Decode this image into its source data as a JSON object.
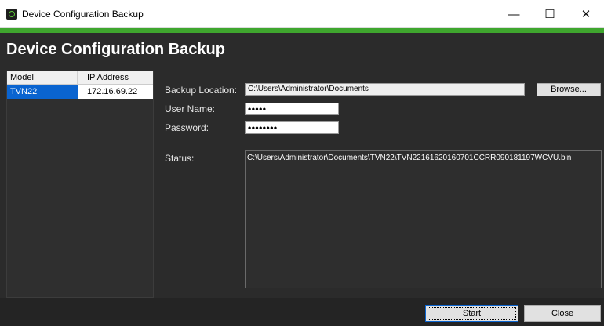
{
  "window": {
    "title": "Device Configuration Backup",
    "controls": {
      "minimize": "—",
      "maximize": "☐",
      "close": "✕"
    }
  },
  "header": {
    "title": "Device Configuration Backup"
  },
  "device_table": {
    "columns": [
      "Model",
      "IP Address"
    ],
    "rows": [
      {
        "model": "TVN22",
        "ip": "172.16.69.22"
      }
    ]
  },
  "form": {
    "backup_location_label": "Backup Location:",
    "backup_location_value": "C:\\Users\\Administrator\\Documents",
    "browse_label": "Browse...",
    "username_label": "User Name:",
    "username_value": "•••••",
    "password_label": "Password:",
    "password_value": "••••••••",
    "status_label": "Status:",
    "status_value": "C:\\Users\\Administrator\\Documents\\TVN22\\TVN22161620160701CCRR090181197WCVU.bin"
  },
  "footer": {
    "start_label": "Start",
    "close_label": "Close"
  },
  "colors": {
    "accent": "#3fa62e",
    "background": "#2b2b2b",
    "selection": "#0a64d0"
  }
}
